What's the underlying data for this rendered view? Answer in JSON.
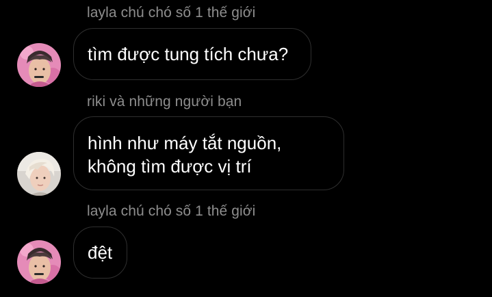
{
  "theme": {
    "background": "#000000",
    "bubble_border": "#2f2f2f",
    "sender_color": "#8e8e8e",
    "text_color": "#ffffff"
  },
  "messages": [
    {
      "sender": "layla chú chó số 1 thế giới",
      "avatar": "pink-avatar",
      "lines": [
        "tìm được tung tích chưa?"
      ]
    },
    {
      "sender": "riki và những người bạn",
      "avatar": "light-avatar",
      "lines": [
        "hình như máy tắt nguồn,",
        "không tìm được vị trí"
      ]
    },
    {
      "sender": "layla chú chó số 1 thế giới",
      "avatar": "pink-avatar",
      "lines": [
        "đệt"
      ]
    }
  ]
}
